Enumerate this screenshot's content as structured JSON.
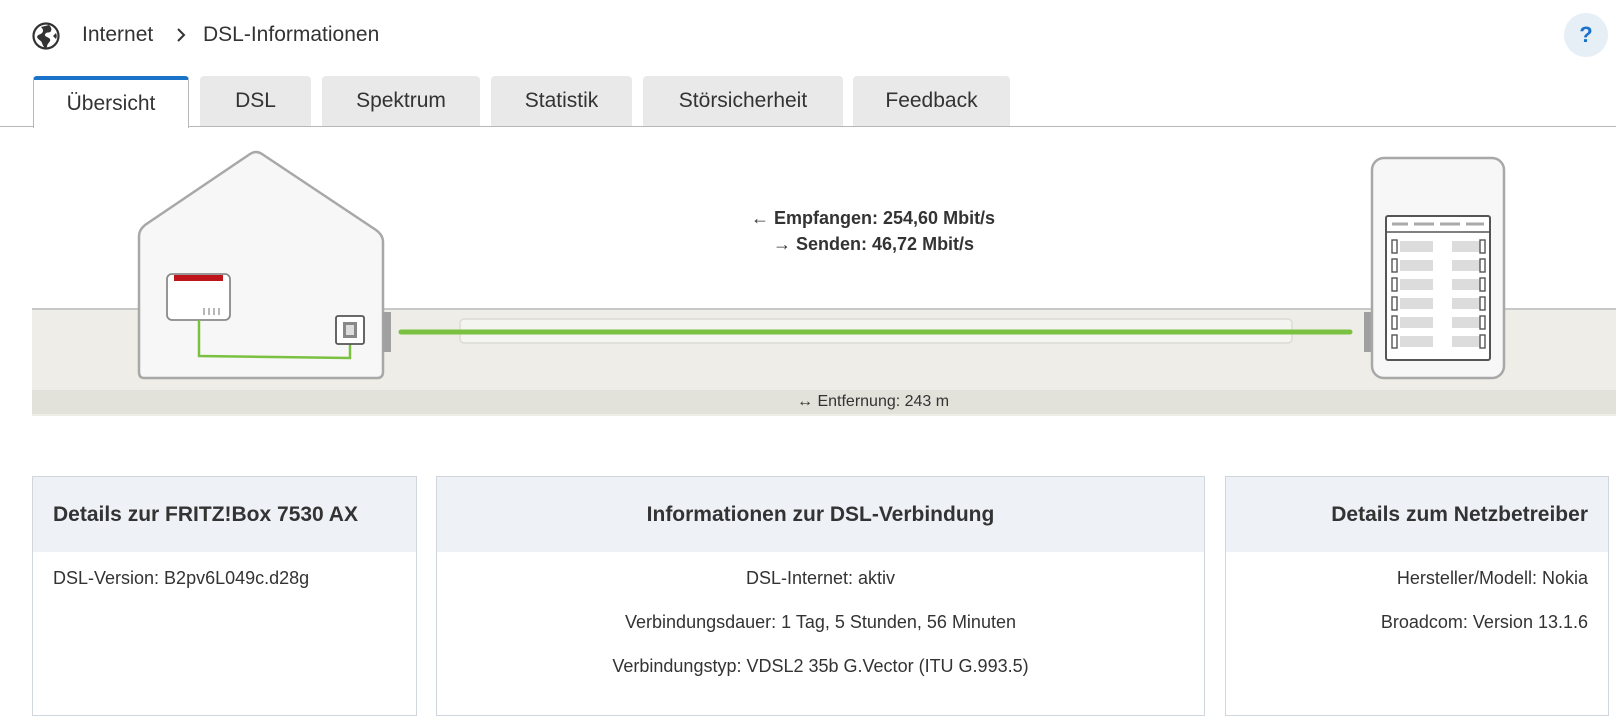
{
  "breadcrumb": {
    "icon": "globe-icon",
    "items": [
      "Internet",
      "DSL-Informationen"
    ]
  },
  "help": {
    "label": "?"
  },
  "tabs": [
    {
      "label": "Übersicht",
      "active": true
    },
    {
      "label": "DSL",
      "active": false
    },
    {
      "label": "Spektrum",
      "active": false
    },
    {
      "label": "Statistik",
      "active": false
    },
    {
      "label": "Störsicherheit",
      "active": false
    },
    {
      "label": "Feedback",
      "active": false
    }
  ],
  "diagram": {
    "receive": "Empfangen: 254,60 Mbit/s",
    "send": "Senden: 46,72 Mbit/s",
    "distance": "Entfernung: 243 m",
    "line_color": "#7ac142",
    "router_accent": "#c0141c"
  },
  "cards": {
    "fritzbox": {
      "title": "Details zur FRITZ!Box 7530 AX",
      "lines": [
        "DSL-Version: B2pv6L049c.d28g"
      ]
    },
    "dsl": {
      "title": "Informationen zur DSL-Verbindung",
      "lines": [
        "DSL-Internet: aktiv",
        "Verbindungsdauer: 1 Tag, 5 Stunden, 56 Minuten",
        "Verbindungstyp: VDSL2 35b G.Vector (ITU G.993.5)"
      ]
    },
    "provider": {
      "title": "Details zum Netzbetreiber",
      "lines": [
        "Hersteller/Modell: Nokia",
        "Broadcom: Version 13.1.6"
      ]
    }
  },
  "colors": {
    "accent": "#1a73c8",
    "tab_bg": "#e9e9e9",
    "card_head_bg": "#eef2f7"
  }
}
